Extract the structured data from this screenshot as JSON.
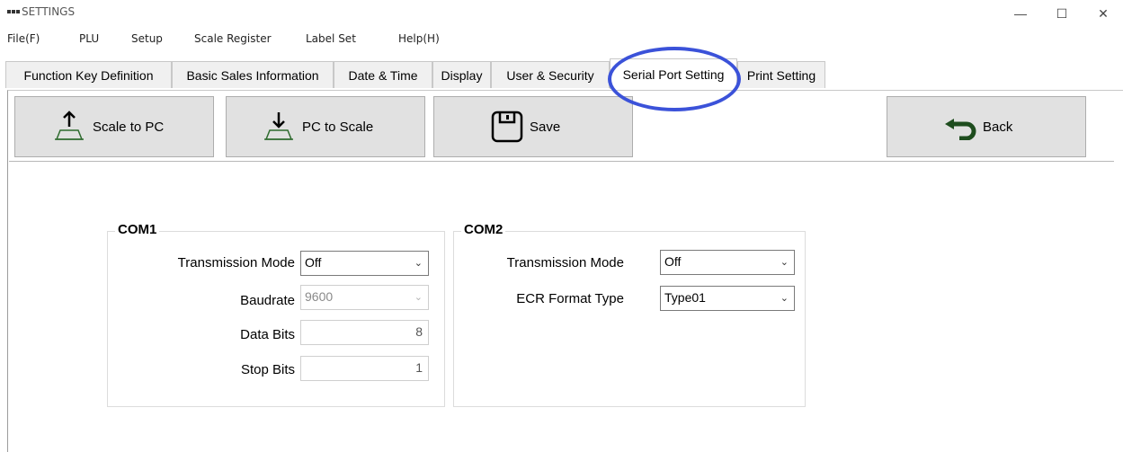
{
  "window": {
    "title": "SETTINGS",
    "min_glyph": "—",
    "max_glyph": "☐",
    "close_glyph": "✕"
  },
  "menu": [
    "File(F)",
    "PLU",
    "Setup",
    "Scale Register",
    "Label Set",
    "Help(H)"
  ],
  "tabs": [
    {
      "label": "Function Key Definition",
      "active": false
    },
    {
      "label": "Basic Sales Information",
      "active": false
    },
    {
      "label": "Date & Time",
      "active": false
    },
    {
      "label": "Display",
      "active": false
    },
    {
      "label": "User & Security",
      "active": false
    },
    {
      "label": "Serial Port Setting",
      "active": true
    },
    {
      "label": "Print Setting",
      "active": false
    }
  ],
  "toolbar": {
    "scale_to_pc": "Scale to PC",
    "pc_to_scale": "PC to Scale",
    "save": "Save",
    "back": "Back"
  },
  "com1": {
    "title": "COM1",
    "transmission_mode_label": "Transmission Mode",
    "transmission_mode_value": "Off",
    "baudrate_label": "Baudrate",
    "baudrate_value": "9600",
    "data_bits_label": "Data Bits",
    "data_bits_value": "8",
    "stop_bits_label": "Stop Bits",
    "stop_bits_value": "1"
  },
  "com2": {
    "title": "COM2",
    "transmission_mode_label": "Transmission Mode",
    "transmission_mode_value": "Off",
    "ecr_format_label": "ECR Format Type",
    "ecr_format_value": "Type01"
  },
  "colors": {
    "highlight": "#3b52d9",
    "icon_green": "#2e6b2e"
  }
}
